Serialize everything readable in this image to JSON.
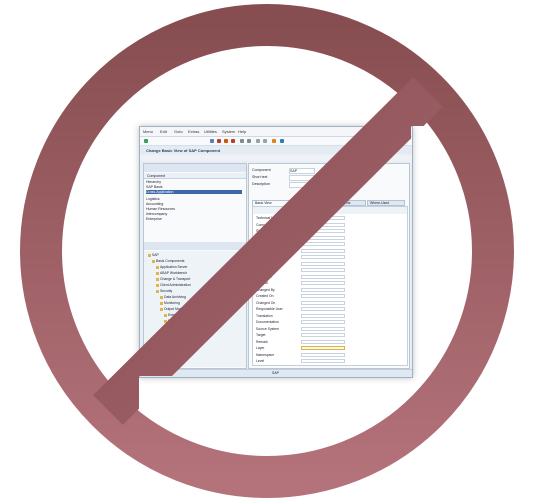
{
  "prohibition_sign": {
    "color": "#a0525b",
    "meaning": "no-symbol"
  },
  "screenshot": {
    "menu": [
      "Menu",
      "Edit",
      "Goto",
      "Extras",
      "Utilities",
      "System",
      "Help"
    ],
    "title": "Change Basic View of SAP Component",
    "tree_header": "Component",
    "left_rows": [
      "Hierarchy",
      "SAP Basis",
      "Cross-Application",
      "Logistics",
      "Accounting",
      "Human Resources",
      "Intercompany",
      "Enterprise"
    ],
    "tree_rows": [
      "SAP",
      "Basis Components",
      "Application Server",
      "ABAP Workbench",
      "Change & Transport",
      "Client Administration",
      "Security",
      "Data Archiving",
      "Monitoring",
      "Output Management",
      "Enterprise Services",
      "Business Workflow",
      "Process Control",
      "Component Object",
      "Documentation",
      "Interfaces"
    ],
    "fields": [
      {
        "label": "Component",
        "value": "SAP"
      },
      {
        "label": "Short text",
        "value": ""
      },
      {
        "label": "Description",
        "value": ""
      }
    ],
    "tabs": [
      "Basic View",
      "Attributes",
      "Assignments",
      "Where-Used"
    ],
    "props": [
      "Technical Name",
      "Component",
      "Short text",
      "Release",
      "Person",
      "Application",
      "Object Type",
      "Package",
      "Status",
      "Sort Order",
      "Original",
      "Changed By",
      "Created On",
      "Changed On",
      "Responsible User",
      "Translation",
      "Documentation",
      "Source System",
      "Target",
      "Remark",
      "Layer",
      "Namespace",
      "Level"
    ],
    "status": "SAP"
  }
}
